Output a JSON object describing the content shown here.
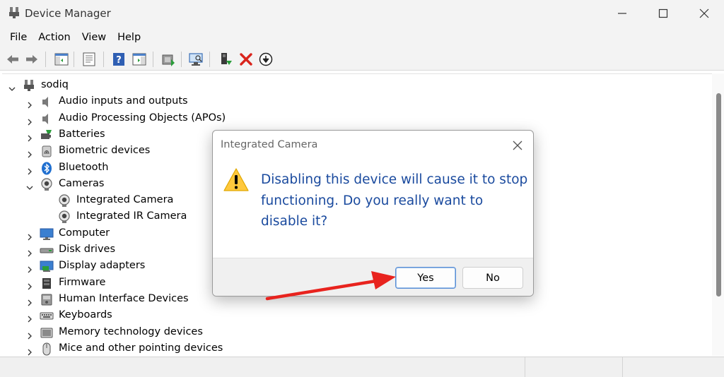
{
  "window": {
    "title": "Device Manager"
  },
  "menu": [
    "File",
    "Action",
    "View",
    "Help"
  ],
  "toolbar": {
    "buttons": [
      "back-icon",
      "forward-icon",
      "show-hide-console-tree-icon",
      "properties-icon",
      "help-icon",
      "action-pane-icon",
      "update-driver-icon",
      "scan-hardware-icon",
      "enable-device-icon",
      "uninstall-device-icon",
      "disable-device-icon"
    ]
  },
  "tree": {
    "root": "sodiq",
    "items": [
      {
        "label": "Audio inputs and outputs",
        "icon": "speaker-icon",
        "expanded": false
      },
      {
        "label": "Audio Processing Objects (APOs)",
        "icon": "speaker-icon",
        "expanded": false
      },
      {
        "label": "Batteries",
        "icon": "battery-icon",
        "expanded": false
      },
      {
        "label": "Biometric devices",
        "icon": "fingerprint-icon",
        "expanded": false
      },
      {
        "label": "Bluetooth",
        "icon": "bluetooth-icon",
        "expanded": false
      },
      {
        "label": "Cameras",
        "icon": "camera-icon",
        "expanded": true
      },
      {
        "label": "Integrated Camera",
        "icon": "camera-icon",
        "child": true
      },
      {
        "label": "Integrated IR Camera",
        "icon": "camera-icon",
        "child": true
      },
      {
        "label": "Computer",
        "icon": "monitor-icon",
        "expanded": false
      },
      {
        "label": "Disk drives",
        "icon": "disk-drive-icon",
        "expanded": false
      },
      {
        "label": "Display adapters",
        "icon": "display-adapter-icon",
        "expanded": false
      },
      {
        "label": "Firmware",
        "icon": "chip-icon",
        "expanded": false
      },
      {
        "label": "Human Interface Devices",
        "icon": "hid-icon",
        "expanded": false
      },
      {
        "label": "Keyboards",
        "icon": "keyboard-icon",
        "expanded": false
      },
      {
        "label": "Memory technology devices",
        "icon": "memory-icon",
        "expanded": false
      },
      {
        "label": "Mice and other pointing devices",
        "icon": "mouse-icon",
        "expanded": false
      }
    ]
  },
  "dialog": {
    "title": "Integrated Camera",
    "message": "Disabling this device will cause it to stop functioning. Do you really want to disable it?",
    "yes_label": "Yes",
    "no_label": "No"
  },
  "colors": {
    "message_text": "#1a4a9e",
    "annotation_arrow": "#e8231e",
    "delete_x": "#d9241c"
  }
}
